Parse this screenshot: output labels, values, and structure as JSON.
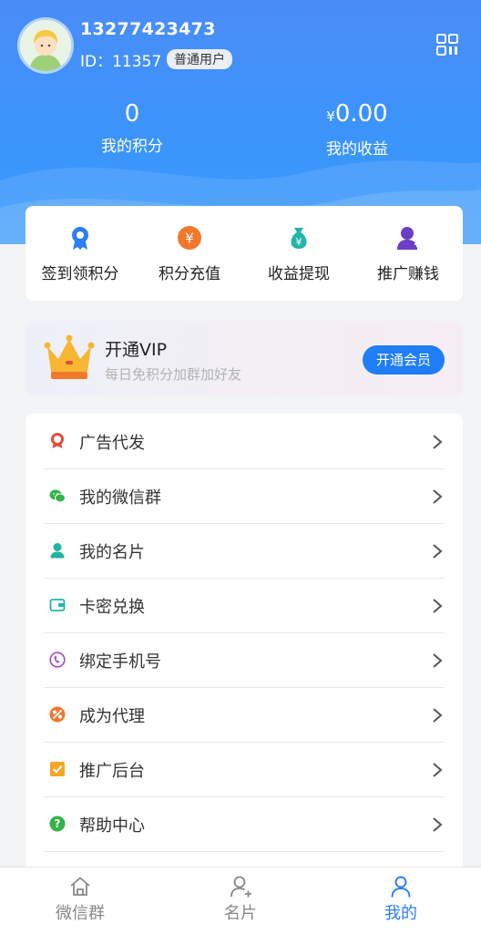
{
  "user": {
    "phone": "13277423473",
    "id_label": "ID：11357",
    "role_badge": "普通用户"
  },
  "stats": {
    "points_value": "0",
    "points_label": "我的积分",
    "earnings_currency": "¥",
    "earnings_value": "0.00",
    "earnings_label": "我的收益"
  },
  "actions": [
    {
      "label": "签到领积分",
      "icon": "badge-icon",
      "color": "#2b7ef6"
    },
    {
      "label": "积分充值",
      "icon": "yen-coin-icon",
      "color": "#f0782d"
    },
    {
      "label": "收益提现",
      "icon": "money-bag-icon",
      "color": "#22b5a9"
    },
    {
      "label": "推广赚钱",
      "icon": "user-add-icon",
      "color": "#6b3fc6"
    }
  ],
  "vip": {
    "title": "开通VIP",
    "subtitle": "每日免积分加群加好友",
    "button": "开通会员"
  },
  "menu": [
    {
      "label": "广告代发",
      "icon": "ribbon-icon",
      "color": "#e14c3c"
    },
    {
      "label": "我的微信群",
      "icon": "wechat-icon",
      "color": "#34b349"
    },
    {
      "label": "我的名片",
      "icon": "person-icon",
      "color": "#1fb59e"
    },
    {
      "label": "卡密兑换",
      "icon": "wallet-icon",
      "color": "#22b5a9"
    },
    {
      "label": "绑定手机号",
      "icon": "phone-icon",
      "color": "#a548c8"
    },
    {
      "label": "成为代理",
      "icon": "agent-icon",
      "color": "#f0782d"
    },
    {
      "label": "推广后台",
      "icon": "checkbox-icon",
      "color": "#f5a623"
    },
    {
      "label": "帮助中心",
      "icon": "help-icon",
      "color": "#34b349"
    }
  ],
  "tabs": [
    {
      "label": "微信群",
      "icon": "home-icon",
      "active": false
    },
    {
      "label": "名片",
      "icon": "user-add-icon",
      "active": false
    },
    {
      "label": "我的",
      "icon": "person-icon",
      "active": true
    }
  ],
  "colors": {
    "primary": "#2b7ef6",
    "header": "#3a95fb"
  }
}
